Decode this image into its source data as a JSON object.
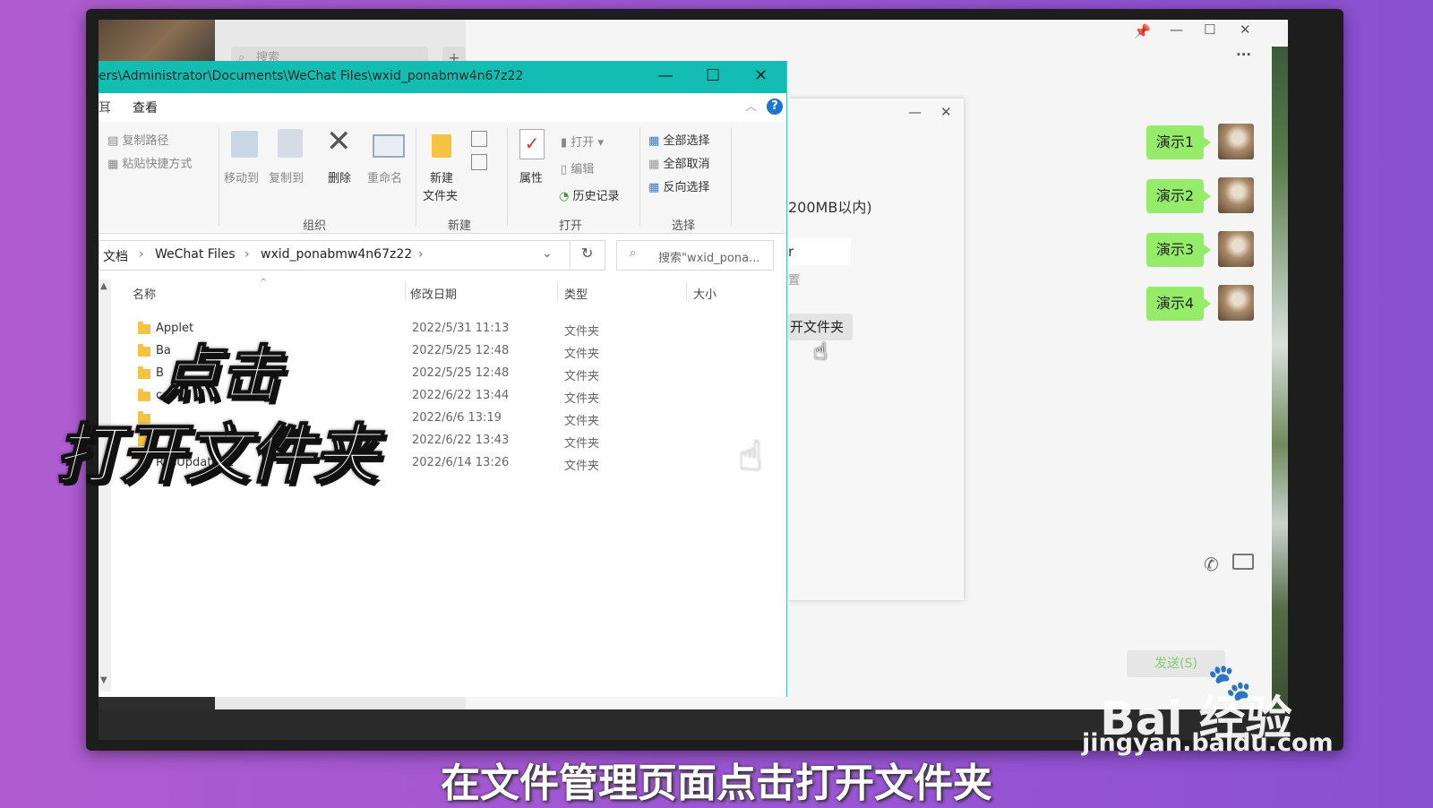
{
  "wechat": {
    "search_placeholder": "搜索",
    "add_label": "+",
    "pin_icon": "pin-icon",
    "more_label": "···",
    "bubbles": [
      "演示1",
      "演示2",
      "演示3",
      "演示4"
    ],
    "send_label": "发送(S)"
  },
  "dialog": {
    "size_note": "200MB以内)",
    "field_fragment": "r",
    "sub_fragment": "置",
    "open_folder_label": "开文件夹"
  },
  "explorer": {
    "title": "ers\\Administrator\\Documents\\WeChat Files\\wxid_ponabmw4n67z22",
    "tabs": [
      "查看"
    ],
    "ribbon": {
      "copy_path": "复制路径",
      "paste_shortcut": "粘贴快捷方式",
      "move_to": "移动到",
      "copy_to": "复制到",
      "delete": "删除",
      "rename": "重命名",
      "new_folder_1": "新建",
      "new_folder_2": "文件夹",
      "properties": "属性",
      "open": "打开",
      "edit": "编辑",
      "history": "历史记录",
      "select_all": "全部选择",
      "select_none": "全部取消",
      "invert_select": "反向选择",
      "group_organize": "组织",
      "group_new": "新建",
      "group_open": "打开",
      "group_select": "选择"
    },
    "address": {
      "crumbs": [
        "文档",
        "WeChat Files",
        "wxid_ponabmw4n67z22"
      ],
      "search_placeholder": "搜索\"wxid_pona..."
    },
    "columns": {
      "name": "名称",
      "date": "修改日期",
      "type": "类型",
      "size": "大小"
    },
    "rows": [
      {
        "name": "Applet",
        "date": "2022/5/31 11:13",
        "type": "文件夹"
      },
      {
        "name": "Ba",
        "date": "2022/5/25 12:48",
        "type": "文件夹"
      },
      {
        "name": "B",
        "date": "2022/5/25 12:48",
        "type": "文件夹"
      },
      {
        "name": "config",
        "date": "2022/6/22 13:44",
        "type": "文件夹"
      },
      {
        "name": "",
        "date": "2022/6/6 13:19",
        "type": "文件夹"
      },
      {
        "name": "",
        "date": "2022/6/22 13:43",
        "type": "文件夹"
      },
      {
        "name": "ResUpdateV2",
        "date": "2022/6/14 13:26",
        "type": "文件夹"
      }
    ]
  },
  "overlay": {
    "line1": "点击",
    "line2": "打开文件夹",
    "subtitle": "在文件管理页面点击打开文件夹",
    "watermark_brand": "Bai 经验",
    "watermark_url": "jingyan.baidu.com"
  }
}
